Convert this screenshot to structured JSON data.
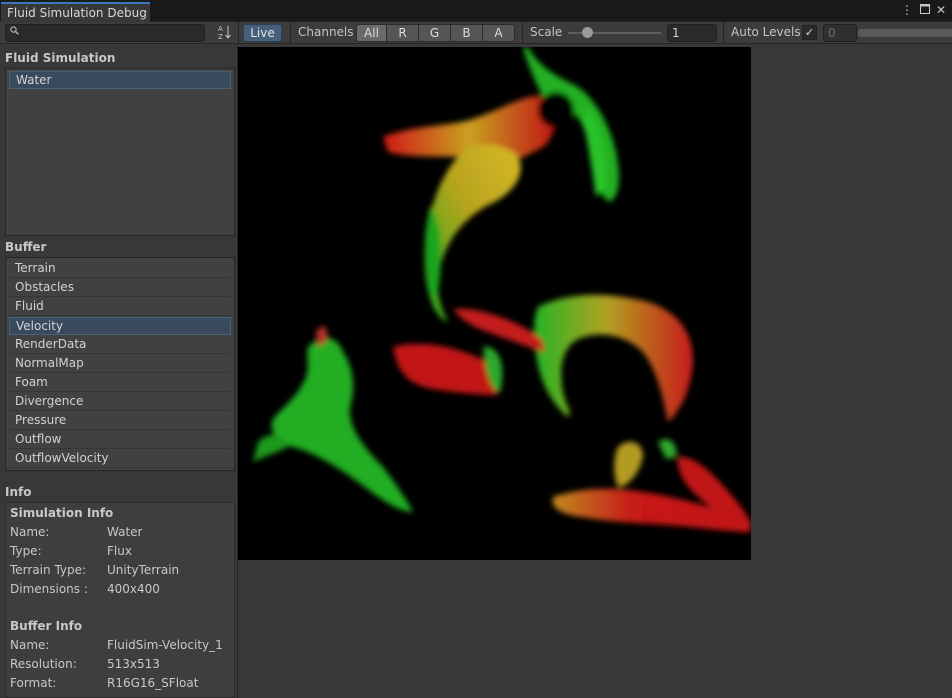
{
  "window": {
    "tab_title": "Fluid Simulation Debug",
    "menu_icon": "kebab-icon",
    "maximize_icon": "maximize-icon",
    "close_icon": "close-icon"
  },
  "toolbar": {
    "search": {
      "value": "",
      "placeholder": ""
    },
    "sort_label": "A↓Z",
    "live_label": "Live",
    "channels_label": "Channels",
    "channels": [
      "All",
      "R",
      "G",
      "B",
      "A"
    ],
    "channels_selected": "All",
    "scale_label": "Scale",
    "scale_value": "1",
    "scale_slider_fraction": 0.2,
    "auto_levels_label": "Auto Levels",
    "auto_levels_checked": true,
    "auto_levels_check_glyph": "✓",
    "levels_min": "0"
  },
  "fluid_simulation": {
    "title": "Fluid Simulation",
    "items": [
      "Water"
    ],
    "selected": "Water"
  },
  "buffer": {
    "title": "Buffer",
    "items": [
      "Terrain",
      "Obstacles",
      "Fluid",
      "Velocity",
      "RenderData",
      "NormalMap",
      "Foam",
      "Divergence",
      "Pressure",
      "Outflow",
      "OutflowVelocity"
    ],
    "selected": "Velocity"
  },
  "info": {
    "title": "Info",
    "simulation_info": {
      "title": "Simulation Info",
      "rows": [
        {
          "key": "Name:",
          "value": "Water"
        },
        {
          "key": "Type:",
          "value": "Flux"
        },
        {
          "key": "Terrain Type:",
          "value": "UnityTerrain"
        },
        {
          "key": "Dimensions :",
          "value": "400x400"
        }
      ]
    },
    "buffer_info": {
      "title": "Buffer Info",
      "rows": [
        {
          "key": "Name:",
          "value": "FluidSim-Velocity_1"
        },
        {
          "key": "Resolution:",
          "value": "513x513"
        },
        {
          "key": "Format:",
          "value": "R16G16_SFloat"
        }
      ]
    }
  },
  "colors": {
    "accent": "#3a79bb",
    "selection": "#3a4a5e",
    "live_button": "#46607c"
  }
}
